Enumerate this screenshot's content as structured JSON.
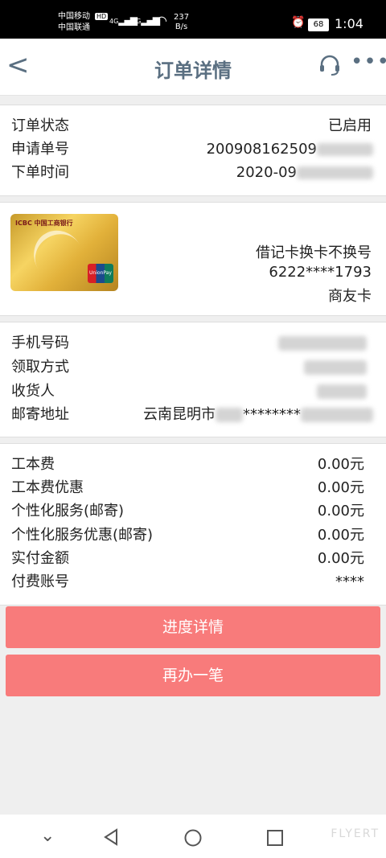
{
  "status_bar": {
    "carrier1": "中国移动",
    "carrier2": "中国联通",
    "hd": "HD",
    "signal1": "4G",
    "signal2": "4G",
    "speed_value": "237",
    "speed_unit": "B/s",
    "battery": "68",
    "time": "1:04"
  },
  "nav": {
    "back": "<",
    "title": "订单详情",
    "more": "•••"
  },
  "order_info": {
    "status_label": "订单状态",
    "status_value": "已启用",
    "number_label": "申请单号",
    "number_value": "200908162509",
    "time_label": "下单时间",
    "time_value": "2020-09"
  },
  "card_info": {
    "bank_logo": "ICBC 中国工商银行",
    "unionpay": "UnionPay",
    "type": "借记卡换卡不换号",
    "number": "6222****1793",
    "name": "商友卡"
  },
  "contact": {
    "phone_label": "手机号码",
    "pickup_label": "领取方式",
    "receiver_label": "收货人",
    "address_label": "邮寄地址",
    "address_value_prefix": "云南昆明市",
    "address_mask": "********"
  },
  "fees": {
    "items": [
      {
        "label": "工本费",
        "value": "0.00元"
      },
      {
        "label": "工本费优惠",
        "value": "0.00元"
      },
      {
        "label": "个性化服务(邮寄)",
        "value": "0.00元"
      },
      {
        "label": "个性化服务优惠(邮寄)",
        "value": "0.00元"
      },
      {
        "label": "实付金额",
        "value": "0.00元"
      },
      {
        "label": "付费账号",
        "value": "****"
      }
    ]
  },
  "buttons": {
    "progress": "进度详情",
    "again": "再办一笔"
  },
  "bottom_nav": {
    "watermark": "FLYERT"
  },
  "colors": {
    "accent": "#f87b7b",
    "nav_text": "#5a6f81"
  }
}
